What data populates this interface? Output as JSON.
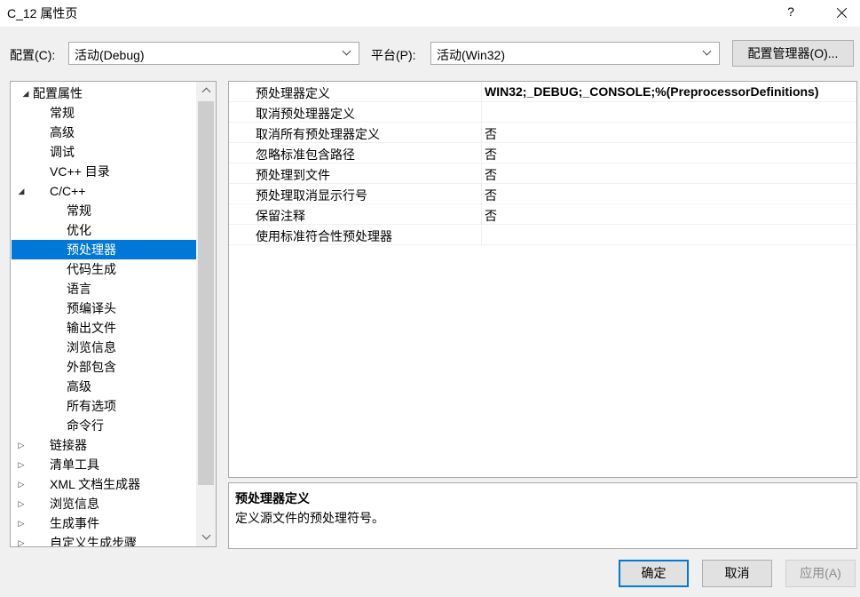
{
  "window": {
    "title": "C_12 属性页",
    "help": "?",
    "close_icon": "close-icon"
  },
  "toolbar": {
    "config_label": "配置(C):",
    "config_value": "活动(Debug)",
    "platform_label": "平台(P):",
    "platform_value": "活动(Win32)",
    "config_manager": "配置管理器(O)..."
  },
  "tree": {
    "items": [
      {
        "label": "配置属性",
        "arrow": "◢",
        "level": 0
      },
      {
        "label": "常规",
        "arrow": "",
        "level": 1
      },
      {
        "label": "高级",
        "arrow": "",
        "level": 1
      },
      {
        "label": "调试",
        "arrow": "",
        "level": 1
      },
      {
        "label": "VC++ 目录",
        "arrow": "",
        "level": 1
      },
      {
        "label": "C/C++",
        "arrow": "◢",
        "level": 1
      },
      {
        "label": "常规",
        "arrow": "",
        "level": 2
      },
      {
        "label": "优化",
        "arrow": "",
        "level": 2
      },
      {
        "label": "预处理器",
        "arrow": "",
        "level": 2,
        "selected": true
      },
      {
        "label": "代码生成",
        "arrow": "",
        "level": 2
      },
      {
        "label": "语言",
        "arrow": "",
        "level": 2
      },
      {
        "label": "预编译头",
        "arrow": "",
        "level": 2
      },
      {
        "label": "输出文件",
        "arrow": "",
        "level": 2
      },
      {
        "label": "浏览信息",
        "arrow": "",
        "level": 2
      },
      {
        "label": "外部包含",
        "arrow": "",
        "level": 2
      },
      {
        "label": "高级",
        "arrow": "",
        "level": 2
      },
      {
        "label": "所有选项",
        "arrow": "",
        "level": 2
      },
      {
        "label": "命令行",
        "arrow": "",
        "level": 2
      },
      {
        "label": "链接器",
        "arrow": "▷",
        "level": 1
      },
      {
        "label": "清单工具",
        "arrow": "▷",
        "level": 1
      },
      {
        "label": "XML 文档生成器",
        "arrow": "▷",
        "level": 1
      },
      {
        "label": "浏览信息",
        "arrow": "▷",
        "level": 1
      },
      {
        "label": "生成事件",
        "arrow": "▷",
        "level": 1
      },
      {
        "label": "自定义生成步骤",
        "arrow": "▷",
        "level": 1
      }
    ]
  },
  "grid": {
    "rows": [
      {
        "name": "预处理器定义",
        "value": "WIN32;_DEBUG;_CONSOLE;%(PreprocessorDefinitions)",
        "bold": true
      },
      {
        "name": "取消预处理器定义",
        "value": "",
        "bold": false
      },
      {
        "name": "取消所有预处理器定义",
        "value": "否",
        "bold": false
      },
      {
        "name": "忽略标准包含路径",
        "value": "否",
        "bold": false
      },
      {
        "name": "预处理到文件",
        "value": "否",
        "bold": false
      },
      {
        "name": "预处理取消显示行号",
        "value": "否",
        "bold": false
      },
      {
        "name": "保留注释",
        "value": "否",
        "bold": false
      },
      {
        "name": "使用标准符合性预处理器",
        "value": "",
        "bold": false
      }
    ]
  },
  "description": {
    "title": "预处理器定义",
    "text": "定义源文件的预处理符号。"
  },
  "buttons": {
    "ok": "确定",
    "cancel": "取消",
    "apply": "应用(A)"
  }
}
